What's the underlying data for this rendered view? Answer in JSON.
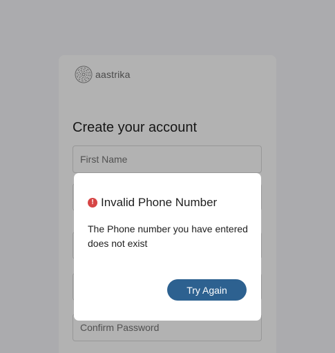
{
  "brand": {
    "name": "aastrika"
  },
  "form": {
    "title": "Create your account",
    "first_name_placeholder": "First Name",
    "confirm_password_placeholder": "Confirm Password"
  },
  "dialog": {
    "icon": "alert-circle-icon",
    "title": "Invalid Phone Number",
    "message": "The Phone number you have entered does not exist",
    "button_label": "Try Again"
  },
  "colors": {
    "accent": "#2d6190",
    "error": "#d64545",
    "background": "#f5f5fa"
  }
}
